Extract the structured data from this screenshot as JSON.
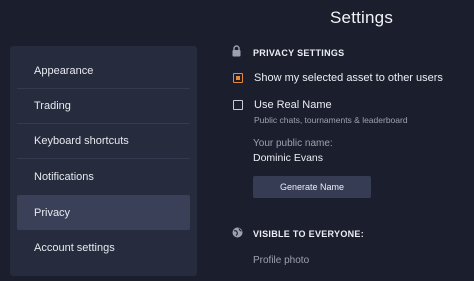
{
  "header": {
    "title": "Settings"
  },
  "sidebar": {
    "items": [
      {
        "label": "Appearance"
      },
      {
        "label": "Trading"
      },
      {
        "label": "Keyboard shortcuts"
      },
      {
        "label": "Notifications"
      },
      {
        "label": "Privacy",
        "active": true
      },
      {
        "label": "Account settings"
      }
    ]
  },
  "privacy": {
    "section_title": "PRIVACY SETTINGS",
    "section_icon": "lock-icon",
    "show_asset_label": "Show my selected asset to other users",
    "show_asset_checked": true,
    "use_real_name_label": "Use Real Name",
    "use_real_name_checked": false,
    "use_real_name_sub": "Public chats, tournaments & leaderboard",
    "public_name_label": "Your public name:",
    "public_name_value": "Dominic Evans",
    "generate_button": "Generate Name"
  },
  "visible": {
    "section_title": "VISIBLE TO EVERYONE:",
    "section_icon": "globe-icon",
    "profile_photo_label": "Profile photo"
  },
  "colors": {
    "background": "#1b1f2d",
    "sidebar": "#262b3d",
    "active_item": "#3a4058",
    "accent": "#e8863a"
  }
}
